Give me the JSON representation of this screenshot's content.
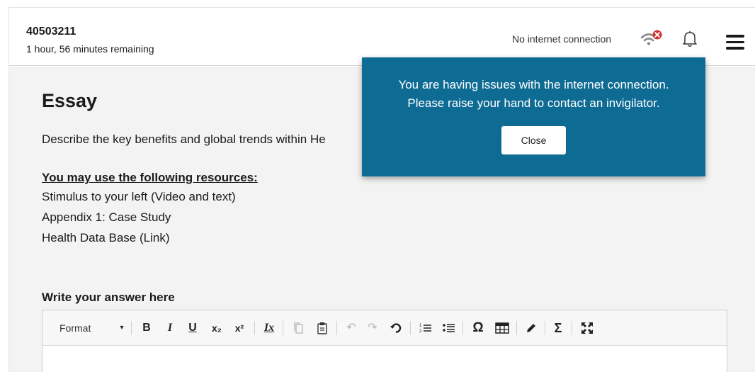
{
  "header": {
    "exam_id": "40503211",
    "time_remaining": "1 hour, 56 minutes remaining",
    "connection_status": "No internet connection",
    "icons": [
      "wifi-error-icon",
      "bell-icon",
      "hamburger-menu-icon"
    ]
  },
  "essay": {
    "title": "Essay",
    "question": "Describe the key benefits and global trends within He",
    "resources_heading": "You may use the following resources:",
    "resources": [
      "Stimulus to your left (Video and text)",
      "Appendix 1: Case Study",
      "Health Data Base (Link)"
    ],
    "answer_label": "Write your answer here"
  },
  "editor": {
    "format_label": "Format",
    "buttons": {
      "bold": "B",
      "italic": "I",
      "underline": "U",
      "subscript": "x₂",
      "superscript": "x²",
      "remove_format": "Ix",
      "undo": "↶",
      "redo": "↷",
      "special_char": "Ω",
      "sum": "Σ"
    }
  },
  "popup": {
    "message_line1": "You are having issues with the internet connection.",
    "message_line2": "Please raise your hand to contact an invigilator.",
    "close_label": "Close"
  },
  "colors": {
    "popup_bg": "#0e6b94",
    "content_bg": "#f3f3f3",
    "error_badge": "#d32f2f"
  }
}
